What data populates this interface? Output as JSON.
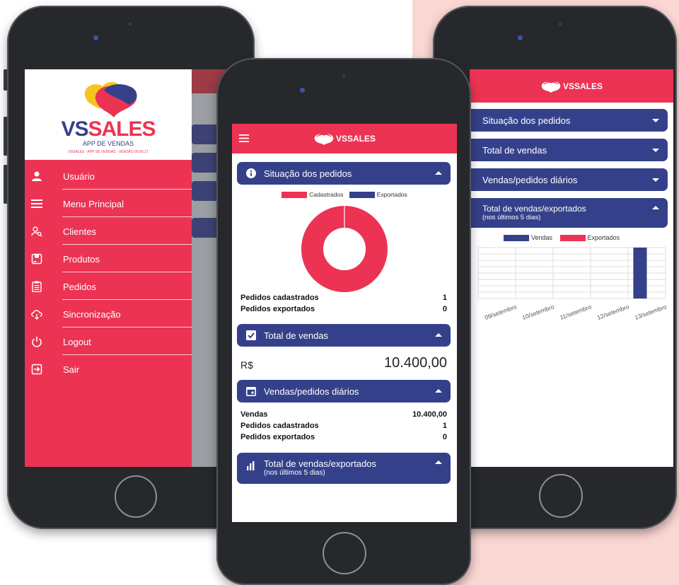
{
  "brand": {
    "name": "VSSALES",
    "name_vs": "VS",
    "name_sales": "SALES",
    "subtitle": "APP DE VENDAS",
    "version_line": "VSSALES - APP DE VENDAS - VERSÃO 00.00.17"
  },
  "colors": {
    "accent_red": "#ec3353",
    "panel_blue": "#34418a",
    "background_pink": "#fbd7d3"
  },
  "drawer": {
    "items": [
      {
        "label": "Usuário",
        "icon": "user-icon"
      },
      {
        "label": "Menu Principal",
        "icon": "menu-icon"
      },
      {
        "label": "Clientes",
        "icon": "search-person-icon"
      },
      {
        "label": "Produtos",
        "icon": "product-box-icon"
      },
      {
        "label": "Pedidos",
        "icon": "clipboard-icon"
      },
      {
        "label": "Sincronização",
        "icon": "cloud-sync-icon"
      },
      {
        "label": "Logout",
        "icon": "power-icon"
      },
      {
        "label": "Sair",
        "icon": "exit-icon"
      }
    ]
  },
  "dashboard": {
    "situacao": {
      "title": "Situação dos pedidos",
      "legend_cadastrados": "Cadastrados",
      "legend_exportados": "Exportados",
      "rows": [
        {
          "label": "Pedidos cadastrados",
          "value": "1"
        },
        {
          "label": "Pedidos exportados",
          "value": "0"
        }
      ]
    },
    "total_vendas": {
      "title": "Total de vendas",
      "currency": "R$",
      "amount": "10.400,00"
    },
    "diarias": {
      "title": "Vendas/pedidos diários",
      "rows": [
        {
          "label": "Vendas",
          "value": "10.400,00"
        },
        {
          "label": "Pedidos cadastrados",
          "value": "1"
        },
        {
          "label": "Pedidos exportados",
          "value": "0"
        }
      ]
    },
    "exportados": {
      "title": "Total de vendas/exportados",
      "subtitle": "(nos últimos 5 dias)"
    }
  },
  "chart_data": [
    {
      "type": "pie",
      "categories": [
        "Cadastrados",
        "Exportados"
      ],
      "values": [
        1,
        0
      ],
      "colors": [
        "#ec3353",
        "#34418a"
      ],
      "legend": "top"
    },
    {
      "type": "bar",
      "categories": [
        "09/setembro",
        "10/setembro",
        "11/setembro",
        "12/setembro",
        "13/setembro"
      ],
      "series": [
        {
          "name": "Vendas",
          "values": [
            0,
            0,
            0,
            0,
            10400
          ],
          "color": "#34418a"
        },
        {
          "name": "Exportados",
          "values": [
            0,
            0,
            0,
            0,
            0
          ],
          "color": "#ec3353"
        }
      ],
      "legend": "top",
      "grid": true
    }
  ]
}
